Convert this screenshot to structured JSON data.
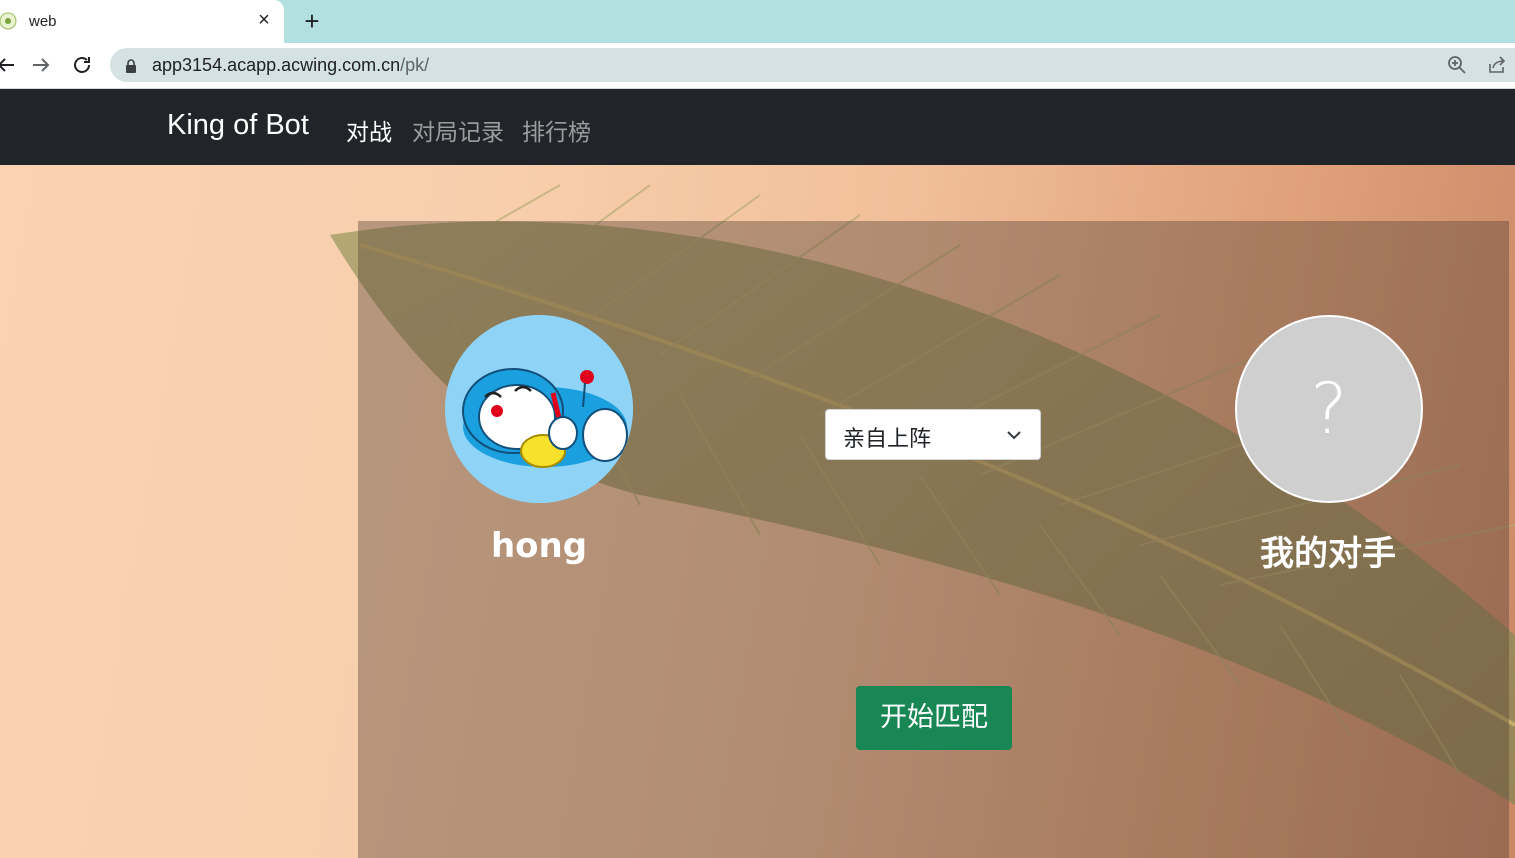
{
  "browser": {
    "tab_title": "web",
    "tab_close": "×",
    "new_tab": "+",
    "url_host": "app3154.acapp.acwing.com.cn",
    "url_path": "/pk/"
  },
  "navbar": {
    "brand": "King of Bot",
    "links": [
      {
        "label": "对战",
        "active": true
      },
      {
        "label": "对局记录",
        "active": false
      },
      {
        "label": "排行榜",
        "active": false
      }
    ]
  },
  "match": {
    "me": {
      "name": "hong"
    },
    "opponent": {
      "name": "我的对手",
      "avatar_placeholder": "?"
    },
    "mode_select": {
      "selected": "亲自上阵"
    },
    "start_button": "开始匹配"
  },
  "colors": {
    "navbar_bg": "#212529",
    "start_button": "#198754",
    "tabstrip": "#b2dfe0"
  }
}
